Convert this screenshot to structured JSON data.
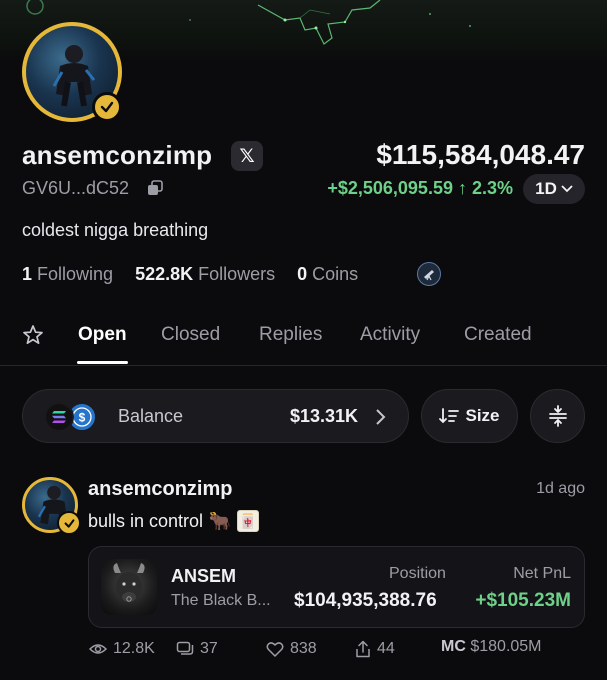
{
  "profile": {
    "username": "ansemconzimp",
    "social_label": "𝕏",
    "address": "GV6U...dC52",
    "bio": "coldest nigga breathing",
    "portfolio_value": "$115,584,048.47",
    "pnl_change": "+$2,506,095.59 ↑ 2.3%",
    "period": "1D",
    "stats": {
      "following_count": "1",
      "following_label": "Following",
      "followers_count": "522.8K",
      "followers_label": "Followers",
      "coins_count": "0",
      "coins_label": "Coins"
    }
  },
  "tabs": [
    "Open",
    "Closed",
    "Replies",
    "Activity",
    "Created"
  ],
  "active_tab": "Open",
  "balance": {
    "label": "Balance",
    "value": "$13.31K",
    "tokens": [
      "sol-icon",
      "usdc-icon"
    ]
  },
  "sort": {
    "label": "Size"
  },
  "post": {
    "username": "ansemconzimp",
    "time": "1d ago",
    "text": "bulls in control",
    "emojis": [
      "🐂",
      "🀄"
    ],
    "trade": {
      "symbol": "ANSEM",
      "name": "The Black B...",
      "position_label": "Position",
      "position_value": "$104,935,388.76",
      "pnl_label": "Net PnL",
      "pnl_value": "+$105.23M"
    },
    "engagement": {
      "views": "12.8K",
      "replies": "37",
      "likes": "838",
      "shares": "44",
      "mc_label": "MC",
      "mc_value": "$180.05M"
    }
  },
  "colors": {
    "background": "#0b0b0d",
    "accent_gold": "#e6b83a",
    "positive": "#6fd089",
    "muted": "#9d9da6"
  }
}
